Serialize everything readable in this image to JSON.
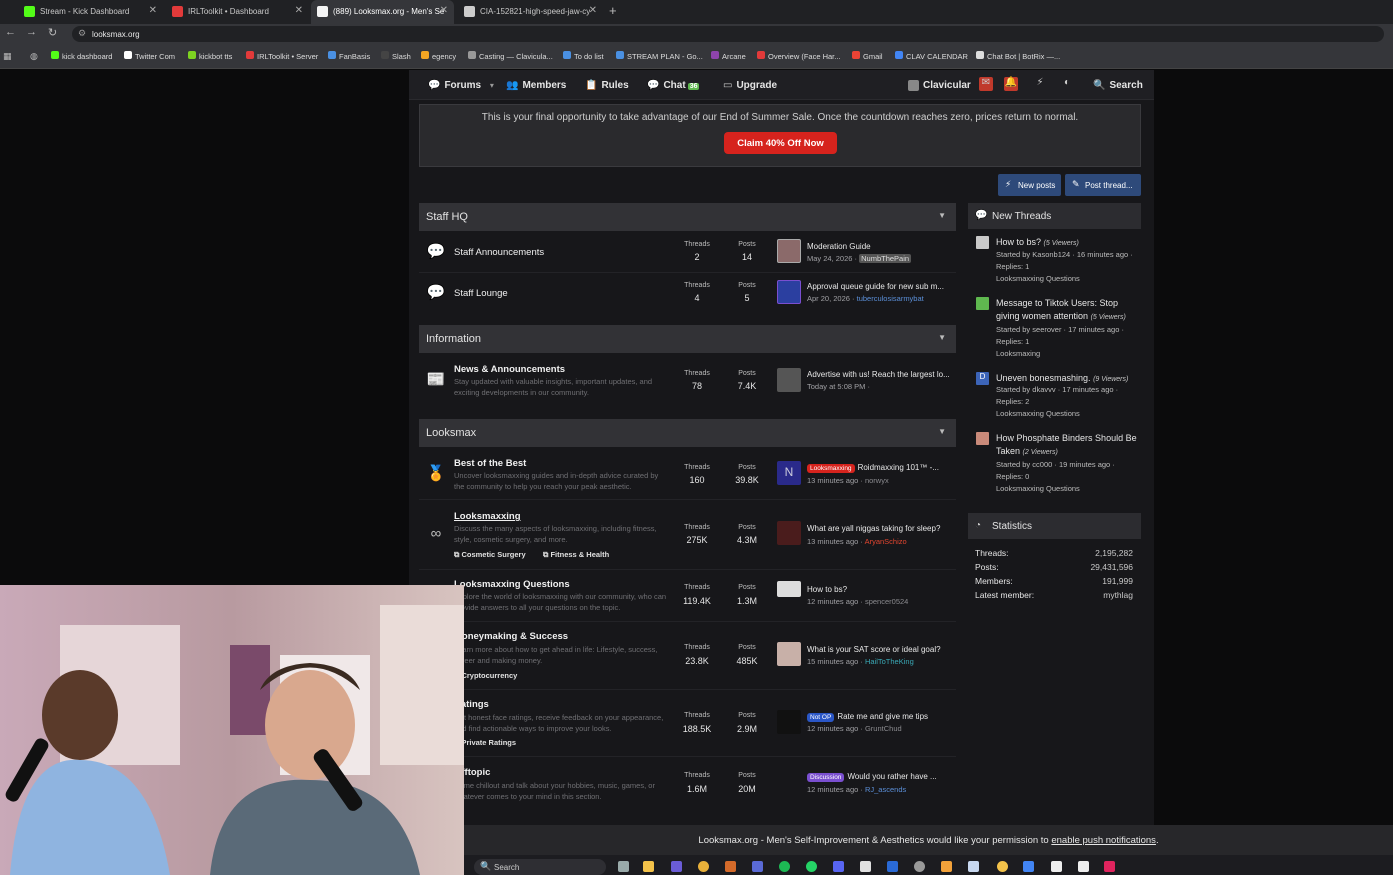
{
  "browser": {
    "tabs": [
      {
        "label": "Stream - Kick Dashboard",
        "color": "#53fc18"
      },
      {
        "label": "IRLToolkit • Dashboard",
        "color": "#e23a3a"
      },
      {
        "label": "(889) Looksmax.org - Men's Se",
        "color": "#f5f5f5"
      },
      {
        "label": "CIA-152821-high-speed-jaw-cy",
        "color": "#cccccc"
      }
    ],
    "url": "looksmax.org",
    "bookmarks": [
      {
        "label": "kick dashboard",
        "color": "#53fc18"
      },
      {
        "label": "Twitter Com",
        "color": "#ffffff"
      },
      {
        "label": "kickbot tts",
        "color": "#7ed321"
      },
      {
        "label": "IRLToolkit • Server",
        "color": "#e23a3a"
      },
      {
        "label": "FanBasis",
        "color": "#4a90e2"
      },
      {
        "label": "Slash",
        "color": "#333333"
      },
      {
        "label": "egency",
        "color": "#f5a623"
      },
      {
        "label": "Casting — Clavicula...",
        "color": "#999999"
      },
      {
        "label": "To do list",
        "color": "#4a90e2"
      },
      {
        "label": "STREAM PLAN - Go...",
        "color": "#4a90e2"
      },
      {
        "label": "Arcane",
        "color": "#8e44ad"
      },
      {
        "label": "Overview (Face Har...",
        "color": "#e23a3a"
      },
      {
        "label": "Gmail",
        "color": "#ea4335"
      },
      {
        "label": "CLAV CALENDAR",
        "color": "#4285f4"
      },
      {
        "label": "Chat Bot | BotRix —...",
        "color": "#dddddd"
      }
    ]
  },
  "forum_nav": {
    "forums": "Forums",
    "members": "Members",
    "rules": "Rules",
    "chat": "Chat",
    "chat_badge": "36",
    "upgrade": "Upgrade",
    "user": "Clavicular",
    "search": "Search"
  },
  "sale": {
    "text": "This is your final opportunity to take advantage of our End of Summer Sale. Once the countdown reaches zero, prices return to normal.",
    "button": "Claim 40% Off Now"
  },
  "actions": {
    "new_posts": "New posts",
    "post_thread": "Post thread..."
  },
  "stat_labels": {
    "threads": "Threads",
    "posts": "Posts"
  },
  "categories": [
    {
      "title": "Staff HQ",
      "nodes": [
        {
          "title": "Staff Announcements",
          "threads": "2",
          "posts": "14",
          "lp_title": "Moderation Guide",
          "lp_date": "May 24, 2026",
          "lp_user": "NumbThePain"
        },
        {
          "title": "Staff Lounge",
          "threads": "4",
          "posts": "5",
          "lp_title": "Approval queue guide for new sub m...",
          "lp_date": "Apr 20, 2026",
          "lp_user": "tuberculosisarmybat"
        }
      ]
    },
    {
      "title": "Information",
      "nodes": [
        {
          "title": "News & Announcements",
          "desc": "Stay updated with valuable insights, important updates, and exciting developments in our community.",
          "threads": "78",
          "posts": "7.4K",
          "lp_title": "Advertise with us! Reach the largest lo...",
          "lp_date": "Today at 5:08 PM",
          "lp_user": ""
        }
      ]
    },
    {
      "title": "Looksmax",
      "nodes": [
        {
          "title": "Best of the Best",
          "desc": "Uncover looksmaxxing guides and in-depth advice curated by the community to help you reach your peak aesthetic.",
          "threads": "160",
          "posts": "39.8K",
          "lp_prefix": "Looksmaxxing",
          "lp_title": "Roidmaxxing 101™ -...",
          "lp_date": "13 minutes ago",
          "lp_user": "norwyx"
        },
        {
          "title": "Looksmaxxing",
          "desc": "Discuss the many aspects of looksmaxxing, including fitness, style, cosmetic surgery, and more.",
          "sub1": "Cosmetic Surgery",
          "sub2": "Fitness & Health",
          "threads": "275K",
          "posts": "4.3M",
          "lp_title": "What are yall niggas taking for sleep?",
          "lp_date": "13 minutes ago",
          "lp_user": "AryanSchizo"
        },
        {
          "title": "Looksmaxxing Questions",
          "desc": "Explore the world of looksmaxxing with our community, who can provide answers to all your questions on the topic.",
          "threads": "119.4K",
          "posts": "1.3M",
          "lp_title": "How to bs?",
          "lp_date": "12 minutes ago",
          "lp_user": "spencer0524"
        },
        {
          "title": "Moneymaking & Success",
          "desc": "Learn more about how to get ahead in life: Lifestyle, success, career and making money.",
          "sub1": "Cryptocurrency",
          "threads": "23.8K",
          "posts": "485K",
          "lp_title": "What is your SAT score or ideal goal?",
          "lp_date": "15 minutes ago",
          "lp_user": "HailToTheKing"
        },
        {
          "title": "Ratings",
          "desc": "Get honest face ratings, receive feedback on your appearance, and find actionable ways to improve your looks.",
          "sub1": "Private Ratings",
          "threads": "188.5K",
          "posts": "2.9M",
          "lp_prefix": "Not OP",
          "lp_title": "Rate me and give me tips",
          "lp_date": "12 minutes ago",
          "lp_user": "GruntChud"
        },
        {
          "title": "Offtopic",
          "desc": "Come chillout and talk about your hobbies, music, games, or whatever comes to your mind in this section.",
          "threads": "1.6M",
          "posts": "20M",
          "lp_prefix": "Discussion",
          "lp_title": "Would you rather have ...",
          "lp_date": "12 minutes ago",
          "lp_user": "RJ_ascends"
        }
      ]
    }
  ],
  "sidebar": {
    "new_threads_title": "New Threads",
    "new_threads": [
      {
        "title": "How to bs?",
        "viewers": "(5 Viewers)",
        "meta": "Started by Kasonb124 · 16 minutes ago · Replies: 1",
        "forum": "Looksmaxxing Questions"
      },
      {
        "title": "Message to Tiktok Users: Stop giving women attention",
        "viewers": "(5 Viewers)",
        "meta": "Started by seerover · 17 minutes ago · Replies: 1",
        "forum": "Looksmaxing"
      },
      {
        "title": "Uneven bonesmashing.",
        "viewers": "(9 Viewers)",
        "meta": "Started by dkavvv · 17 minutes ago · Replies: 2",
        "forum": "Looksmaxxing Questions"
      },
      {
        "title": "How Phosphate Binders Should Be Taken",
        "viewers": "(2 Viewers)",
        "meta": "Started by cc000 · 19 minutes ago · Replies: 0",
        "forum": "Looksmaxxing Questions"
      }
    ],
    "stats_title": "Statistics",
    "stats": [
      {
        "label": "Threads:",
        "value": "2,195,282"
      },
      {
        "label": "Posts:",
        "value": "29,431,596"
      },
      {
        "label": "Members:",
        "value": "191,999"
      },
      {
        "label": "Latest member:",
        "value": "mythlag"
      }
    ]
  },
  "notice": {
    "text": "Looksmax.org - Men's Self-Improvement & Aesthetics would like your permission to ",
    "link": "enable push notifications",
    "end": "."
  },
  "taskbar": {
    "search": "Search"
  }
}
